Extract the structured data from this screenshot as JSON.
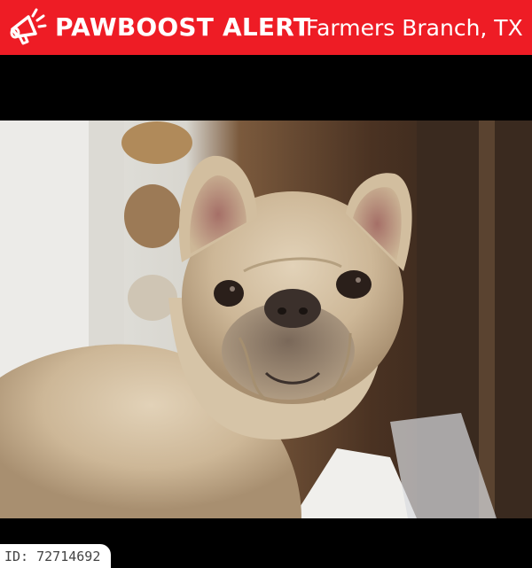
{
  "header": {
    "brand": "PAWBOOST ALERT",
    "location": "Farmers Branch, TX",
    "icon": "megaphone-icon",
    "background_color": "#ee1c25"
  },
  "photo": {
    "subject": "dog-photo"
  },
  "badge": {
    "id_text": "ID: 72714692"
  }
}
